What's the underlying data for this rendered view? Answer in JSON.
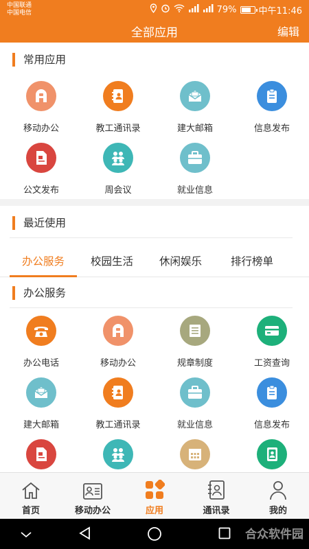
{
  "status": {
    "carrier1": "中国联通",
    "carrier2": "中国电信",
    "battery": "79%",
    "time": "中午11:46",
    "battery_level": 0.79
  },
  "header": {
    "title": "全部应用",
    "edit": "编辑"
  },
  "colors": {
    "accent": "#f07d1f",
    "orange": "#f07d1f",
    "salmon": "#f0926a",
    "teal": "#3eb7b6",
    "tealblue": "#6fbfcb",
    "blue": "#3b8ede",
    "red": "#d9463f",
    "olive": "#a7a87e",
    "green": "#1db07a",
    "tan": "#d7b279"
  },
  "common": {
    "title": "常用应用",
    "apps": [
      {
        "label": "移动办公",
        "icon": "mobile-office-icon",
        "color": "salmon"
      },
      {
        "label": "教工通讯录",
        "icon": "contacts-book-icon",
        "color": "orange"
      },
      {
        "label": "建大邮箱",
        "icon": "mailbox-icon",
        "color": "tealblue"
      },
      {
        "label": "信息发布",
        "icon": "clipboard-icon",
        "color": "blue"
      },
      {
        "label": "公文发布",
        "icon": "document-icon",
        "color": "red"
      },
      {
        "label": "周会议",
        "icon": "meeting-icon",
        "color": "teal"
      },
      {
        "label": "就业信息",
        "icon": "briefcase-icon",
        "color": "tealblue"
      }
    ]
  },
  "recent": {
    "title": "最近使用"
  },
  "tabs": [
    {
      "label": "办公服务",
      "active": true
    },
    {
      "label": "校园生活"
    },
    {
      "label": "休闲娱乐"
    },
    {
      "label": "排行榜单"
    }
  ],
  "office": {
    "title": "办公服务",
    "apps": [
      {
        "label": "办公电话",
        "icon": "telephone-icon",
        "color": "orange"
      },
      {
        "label": "移动办公",
        "icon": "mobile-office-icon",
        "color": "salmon"
      },
      {
        "label": "规章制度",
        "icon": "rules-list-icon",
        "color": "olive"
      },
      {
        "label": "工资查询",
        "icon": "salary-card-icon",
        "color": "green"
      },
      {
        "label": "建大邮箱",
        "icon": "mailbox-icon",
        "color": "tealblue"
      },
      {
        "label": "教工通讯录",
        "icon": "contacts-book-icon",
        "color": "orange"
      },
      {
        "label": "就业信息",
        "icon": "briefcase-icon",
        "color": "tealblue"
      },
      {
        "label": "信息发布",
        "icon": "clipboard-icon",
        "color": "blue"
      },
      {
        "label": "",
        "icon": "document-icon",
        "color": "red"
      },
      {
        "label": "",
        "icon": "meeting-icon",
        "color": "teal"
      },
      {
        "label": "",
        "icon": "calendar-icon",
        "color": "tan"
      },
      {
        "label": "",
        "icon": "address-book-icon",
        "color": "green"
      }
    ]
  },
  "bottom_nav": [
    {
      "label": "首页",
      "icon": "home-icon"
    },
    {
      "label": "移动办公",
      "icon": "mobile-office-icon"
    },
    {
      "label": "应用",
      "icon": "apps-grid-icon",
      "active": true
    },
    {
      "label": "通讯录",
      "icon": "contacts-icon"
    },
    {
      "label": "我的",
      "icon": "profile-icon"
    }
  ],
  "watermark": "合众软件园"
}
